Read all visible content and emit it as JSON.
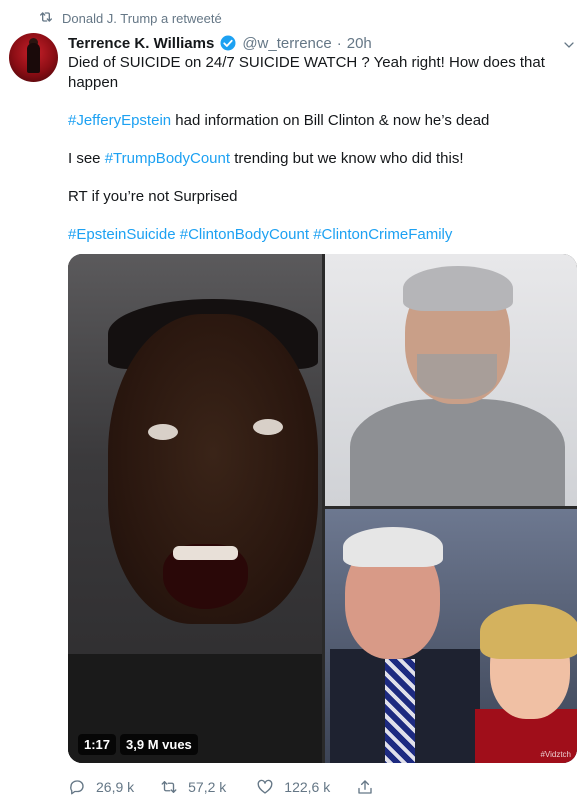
{
  "retweet_context": {
    "icon": "retweet-icon",
    "text": "Donald J. Trump a retweeté"
  },
  "tweet": {
    "author_name": "Terrence K. Williams",
    "author_handle": "@w_terrence",
    "separator": "·",
    "time": "20h",
    "verified_icon": "verified-badge-icon",
    "lines": {
      "l1": "Died of SUICIDE on 24/7 SUICIDE WATCH ? Yeah right! How does that",
      "l2": "happen",
      "l3_tag": "#JefferyEpstein",
      "l3_rest": " had information on Bill Clinton & now he’s dead",
      "l4_pre": "I see ",
      "l4_tag": "#TrumpBodyCount",
      "l4_rest": " trending but we know who did this!",
      "l5": "RT if you’re not Surprised",
      "h1": "#EpsteinSuicide",
      "h2": "#ClintonBodyCount",
      "h3": "#ClintonCrimeFamily"
    },
    "media": {
      "duration": "1:17",
      "views": "3,9 M vues",
      "watermark": "#Vidztch"
    },
    "actions": {
      "reply_count": "26,9 k",
      "retweet_count": "57,2 k",
      "like_count": "122,6 k"
    }
  },
  "colors": {
    "link": "#1da1f2",
    "secondary": "#657786",
    "text": "#14171a"
  }
}
